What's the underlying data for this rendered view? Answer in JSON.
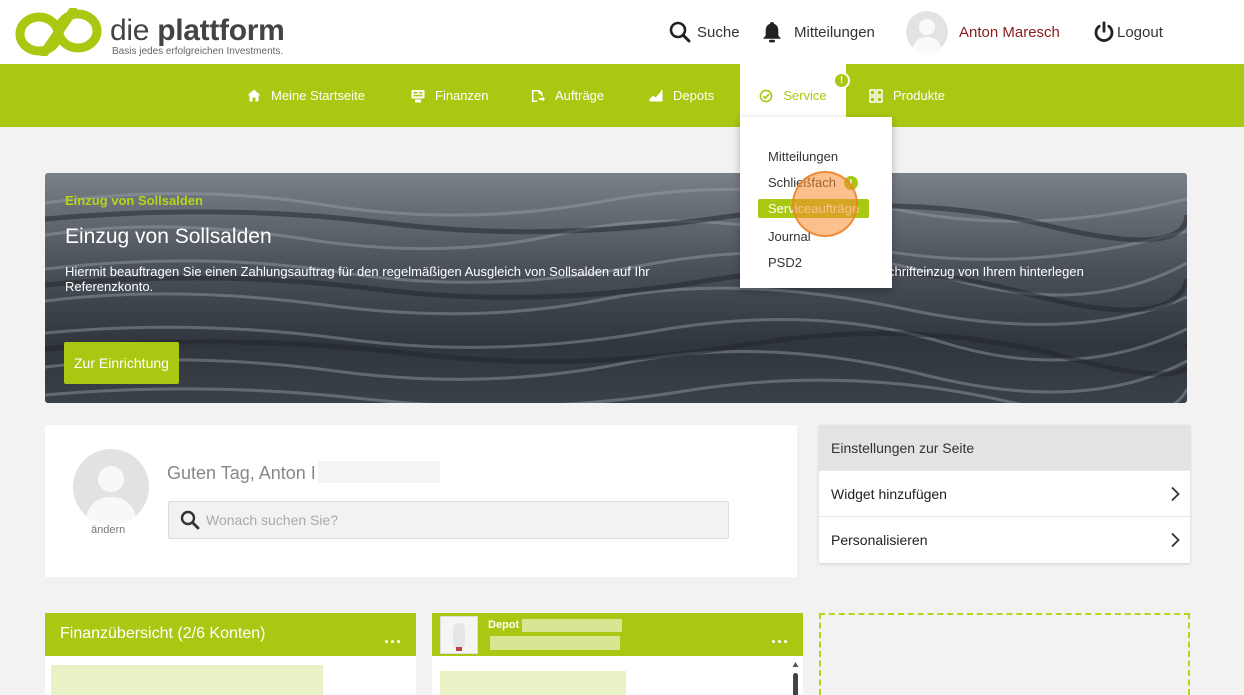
{
  "header": {
    "brand_prefix": "die",
    "brand_name": "plattform",
    "tagline": "Basis jedes erfolgreichen Investments.",
    "search_label": "Suche",
    "notifications_label": "Mitteilungen",
    "user_name": "Anton Maresch",
    "logout_label": "Logout"
  },
  "nav": {
    "items": [
      {
        "label": "Meine Startseite",
        "icon": "home-icon"
      },
      {
        "label": "Finanzen",
        "icon": "finance-icon"
      },
      {
        "label": "Aufträge",
        "icon": "orders-icon"
      },
      {
        "label": "Depots",
        "icon": "depots-icon"
      },
      {
        "label": "Service",
        "icon": "check-circle-icon",
        "active": true,
        "badge": "!"
      },
      {
        "label": "Produkte",
        "icon": "grid-icon"
      }
    ]
  },
  "service_menu": {
    "items": [
      {
        "label": "Mitteilungen"
      },
      {
        "label": "Schließfach",
        "badge": "!"
      },
      {
        "label": "Serviceaufträge",
        "highlighted": true
      },
      {
        "label": "Journal"
      },
      {
        "label": "PSD2"
      }
    ]
  },
  "banner": {
    "eyebrow": "Einzug von Sollsalden",
    "title": "Einzug von Sollsalden",
    "text": "Hiermit beauftragen Sie einen Zahlungsauftrag für den regelmäßigen Ausgleich von Sollsalden auf Ihr                                              mittels Lastschrifteinzug von Ihrem hinterlegen Referenzkonto.",
    "button_label": "Zur Einrichtung"
  },
  "greeting": {
    "text": "Guten Tag, Anton I",
    "change_label": "ändern",
    "search_placeholder": "Wonach suchen Sie?"
  },
  "settings": {
    "header": "Einstellungen zur Seite",
    "rows": [
      {
        "label": "Widget hinzufügen"
      },
      {
        "label": "Personalisieren"
      }
    ]
  },
  "widgets": {
    "finance_title": "Finanzübersicht (2/6 Konten)",
    "depot_title": "Depot",
    "menu_label": "..."
  },
  "colors": {
    "brand_green": "#a9c812",
    "user_name": "#8b1a1a"
  }
}
